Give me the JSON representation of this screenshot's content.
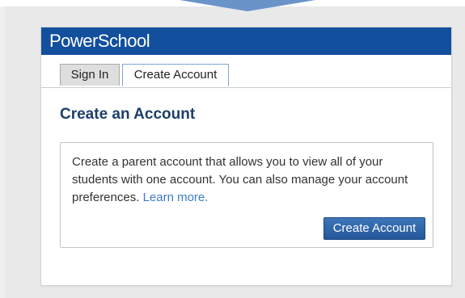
{
  "brand": {
    "name": "PowerSchool"
  },
  "tabs": [
    {
      "label": "Sign In",
      "selected": false
    },
    {
      "label": "Create Account",
      "selected": true
    }
  ],
  "main": {
    "title": "Create an Account",
    "description": "Create a parent account that allows you to view all of your students with one account. You can also manage your account preferences.",
    "learn_more_label": "Learn more.",
    "create_button_label": "Create Account"
  },
  "colors": {
    "brand_bar": "#12509e",
    "accent_link": "#3b7cc4",
    "button": "#23579a",
    "title": "#1d3f6a"
  }
}
